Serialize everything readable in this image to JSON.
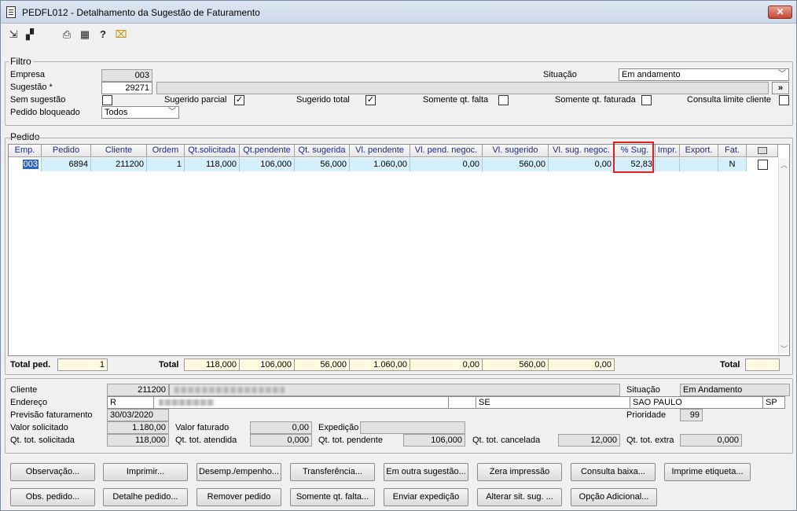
{
  "window": {
    "title": "PEDFL012 - Detalhamento da Sugestão de Faturamento",
    "close": "✕"
  },
  "toolbar": [
    {
      "name": "export-icon",
      "glyph": "⇲"
    },
    {
      "name": "window-icon",
      "glyph": "▞"
    },
    {
      "name": "print-icon",
      "glyph": "⎙"
    },
    {
      "name": "calendar-icon",
      "glyph": "▦"
    },
    {
      "name": "help-icon",
      "glyph": "?"
    },
    {
      "name": "exit-icon",
      "glyph": "⌧"
    }
  ],
  "filtro": {
    "legend": "Filtro",
    "empresa_label": "Empresa",
    "empresa": "003",
    "sugestao_label": "Sugestão *",
    "sugestao": "29271",
    "situacao_label": "Situação",
    "situacao": "Em andamento",
    "sem_sugestao_label": "Sem sugestão",
    "sugerido_parcial_label": "Sugerido parcial",
    "sugerido_total_label": "Sugerido total",
    "somente_falta_label": "Somente qt. falta",
    "somente_faturada_label": "Somente qt. faturada",
    "consulta_limite_label": "Consulta limite cliente",
    "pedido_bloqueado_label": "Pedido bloqueado",
    "pedido_bloqueado": "Todos",
    "lookup_button": "»",
    "checkmark": "✓"
  },
  "pedido": {
    "legend": "Pedido",
    "columns": [
      "Emp.",
      "Pedido",
      "Cliente",
      "Ordem",
      "Qt.solicitada",
      "Qt.pendente",
      "Qt. sugerida",
      "Vl. pendente",
      "Vl. pend. negoc.",
      "Vl. sugerido",
      "Vl. sug. negoc.",
      "% Sug.",
      "Impr.",
      "Export.",
      "Fat."
    ],
    "row": [
      "003",
      "6894",
      "211200",
      "1",
      "118,000",
      "106,000",
      "56,000",
      "1.060,00",
      "0,00",
      "560,00",
      "0,00",
      "52,83",
      "",
      "",
      "N"
    ],
    "total_ped_label": "Total ped.",
    "total_ped": "1",
    "total_label": "Total",
    "totals": [
      "118,000",
      "106,000",
      "56,000",
      "1.060,00",
      "0,00",
      "560,00",
      "0,00"
    ],
    "total_right_label": "Total",
    "total_right": ""
  },
  "detalhe": {
    "cliente_label": "Cliente",
    "cliente": "211200",
    "situacao_label": "Situação",
    "situacao": "Em Andamento",
    "endereco_label": "Endereço",
    "endereco": "R",
    "uf1": "SE",
    "cidade": "SAO PAULO",
    "uf2": "SP",
    "previsao_label": "Previsão faturamento",
    "previsao": "30/03/2020",
    "prioridade_label": "Prioridade",
    "prioridade": "99",
    "valor_solicitado_label": "Valor solicitado",
    "valor_solicitado": "1.180,00",
    "valor_faturado_label": "Valor faturado",
    "valor_faturado": "0,00",
    "expedicao_label": "Expedição",
    "expedicao": "",
    "qt_tot_solicitada_label": "Qt. tot. solicitada",
    "qt_tot_solicitada": "118,000",
    "qt_tot_atendida_label": "Qt. tot. atendida",
    "qt_tot_atendida": "0,000",
    "qt_tot_pendente_label": "Qt. tot. pendente",
    "qt_tot_pendente": "106,000",
    "qt_tot_cancelada_label": "Qt. tot. cancelada",
    "qt_tot_cancelada": "12,000",
    "qt_tot_extra_label": "Qt. tot. extra",
    "qt_tot_extra": "0,000"
  },
  "buttons_row1": [
    "Observação...",
    "Imprimir...",
    "Desemp./empenho...",
    "Transferência...",
    "Em outra sugestão...",
    "Zera impressão",
    "Consulta baixa...",
    "Imprime etiqueta..."
  ],
  "buttons_row2": [
    "Obs. pedido...",
    "Detalhe pedido...",
    "Remover pedido",
    "Somente qt. falta...",
    "Enviar expedição",
    "Alterar sit. sug. ...",
    "Opção Adicional..."
  ]
}
